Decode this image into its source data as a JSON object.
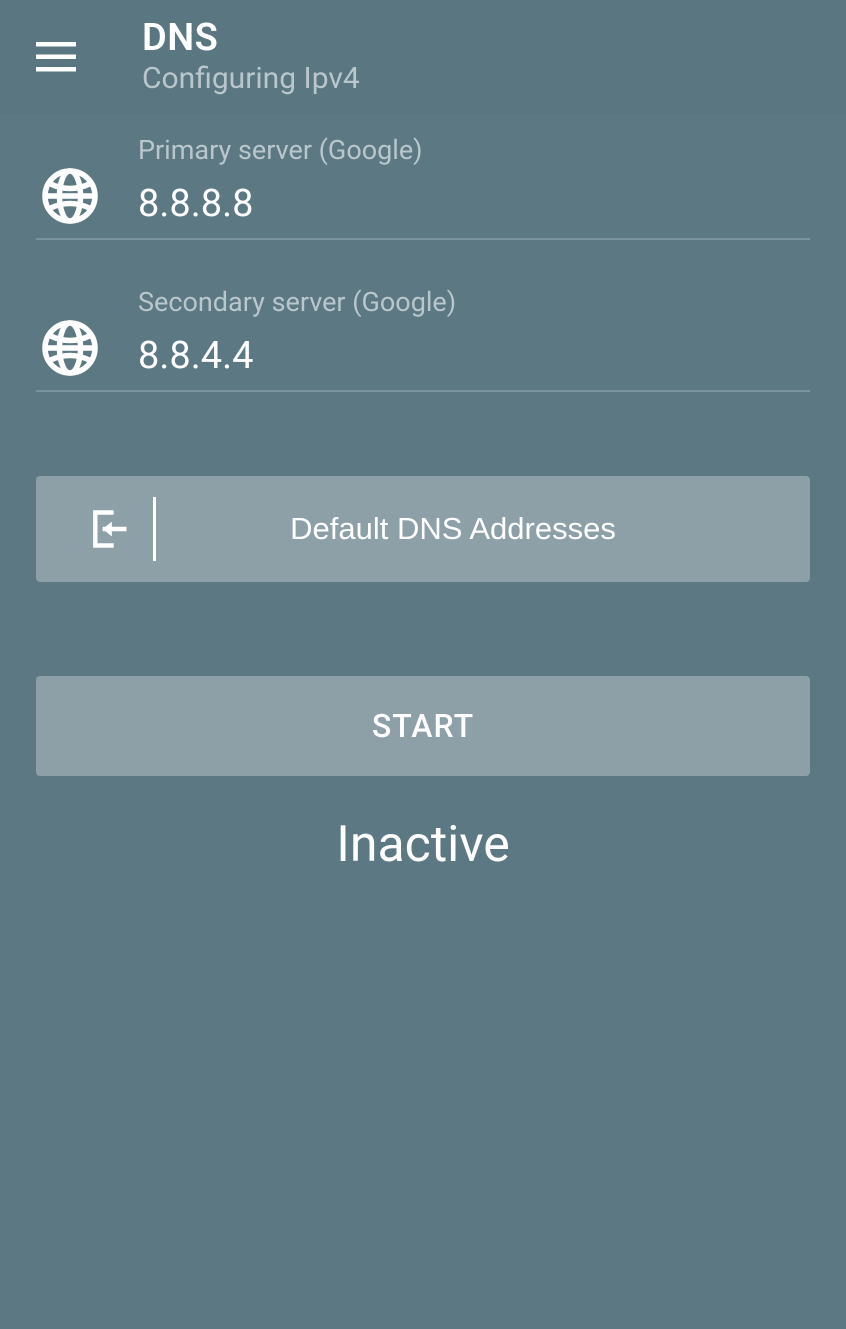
{
  "header": {
    "title": "DNS",
    "subtitle": "Configuring Ipv4"
  },
  "primary": {
    "label": "Primary server (Google)",
    "value": "8.8.8.8"
  },
  "secondary": {
    "label": "Secondary server (Google)",
    "value": "8.8.4.4"
  },
  "default_btn": "Default DNS Addresses",
  "start_btn": "START",
  "status": "Inactive"
}
